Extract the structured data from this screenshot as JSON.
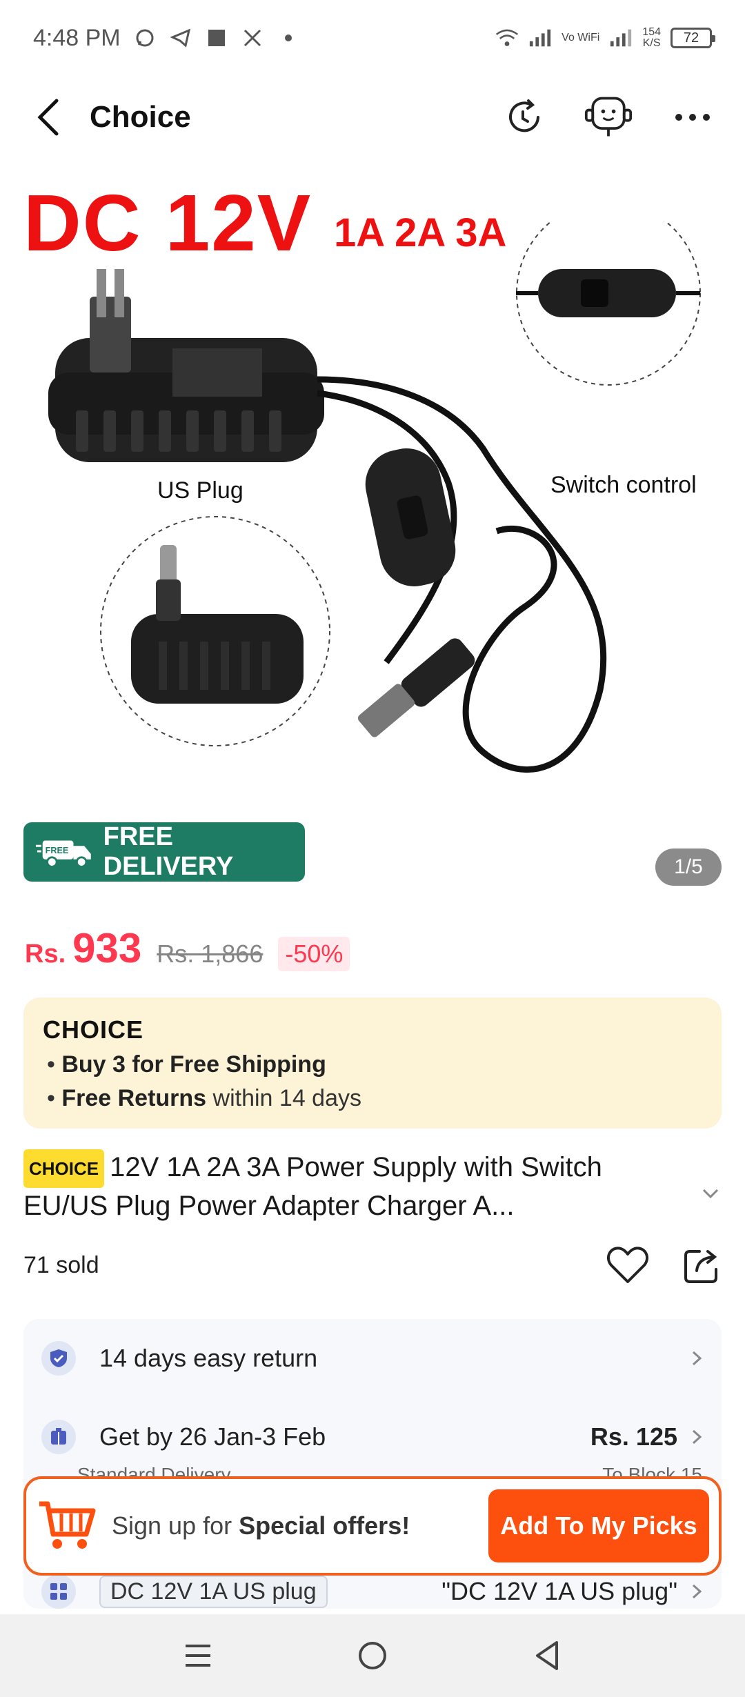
{
  "status_bar": {
    "time": "4:48 PM",
    "net_speed_value": "154",
    "net_speed_unit": "K/S",
    "battery": "72",
    "vo_wifi": "Vo WiFi"
  },
  "nav": {
    "title": "Choice"
  },
  "product_image": {
    "headline": "DC 12V",
    "sub_headline": "1A 2A 3A",
    "caption_us_plug": "US Plug",
    "caption_switch": "Switch control",
    "free_delivery_label": "FREE DELIVERY",
    "free_badge": "FREE",
    "counter": "1/5"
  },
  "price": {
    "currency": "Rs.",
    "current": "933",
    "original": "Rs. 1,866",
    "discount": "-50%"
  },
  "choice_banner": {
    "logo": "CHOICE",
    "line1_bold": "Buy 3 for  Free Shipping",
    "line2_bold": "Free Returns",
    "line2_rest": " within 14 days"
  },
  "title": {
    "tag": "CHOICE",
    "text": "12V 1A 2A 3A Power Supply with Switch EU/US Plug Power Adapter Charger A..."
  },
  "sold": {
    "label": "71 sold"
  },
  "services": {
    "return_label": "14 days easy return",
    "delivery_label": "Get by 26 Jan-3 Feb",
    "delivery_price": "Rs. 125",
    "delivery_sub": "Standard Delivery",
    "delivery_dest": "To Block 15",
    "variant_chip": "DC 12V 1A US plug",
    "variant_value": "\"DC 12V 1A US plug\""
  },
  "signup": {
    "prefix": "Sign up for ",
    "bold": "Special offers!",
    "button": "Add To My Picks"
  },
  "colors": {
    "price_red": "#fd384f",
    "brand_orange": "#fd4f0d",
    "delivery_green": "#1e7c64",
    "choice_yellow": "#fedc2f"
  }
}
